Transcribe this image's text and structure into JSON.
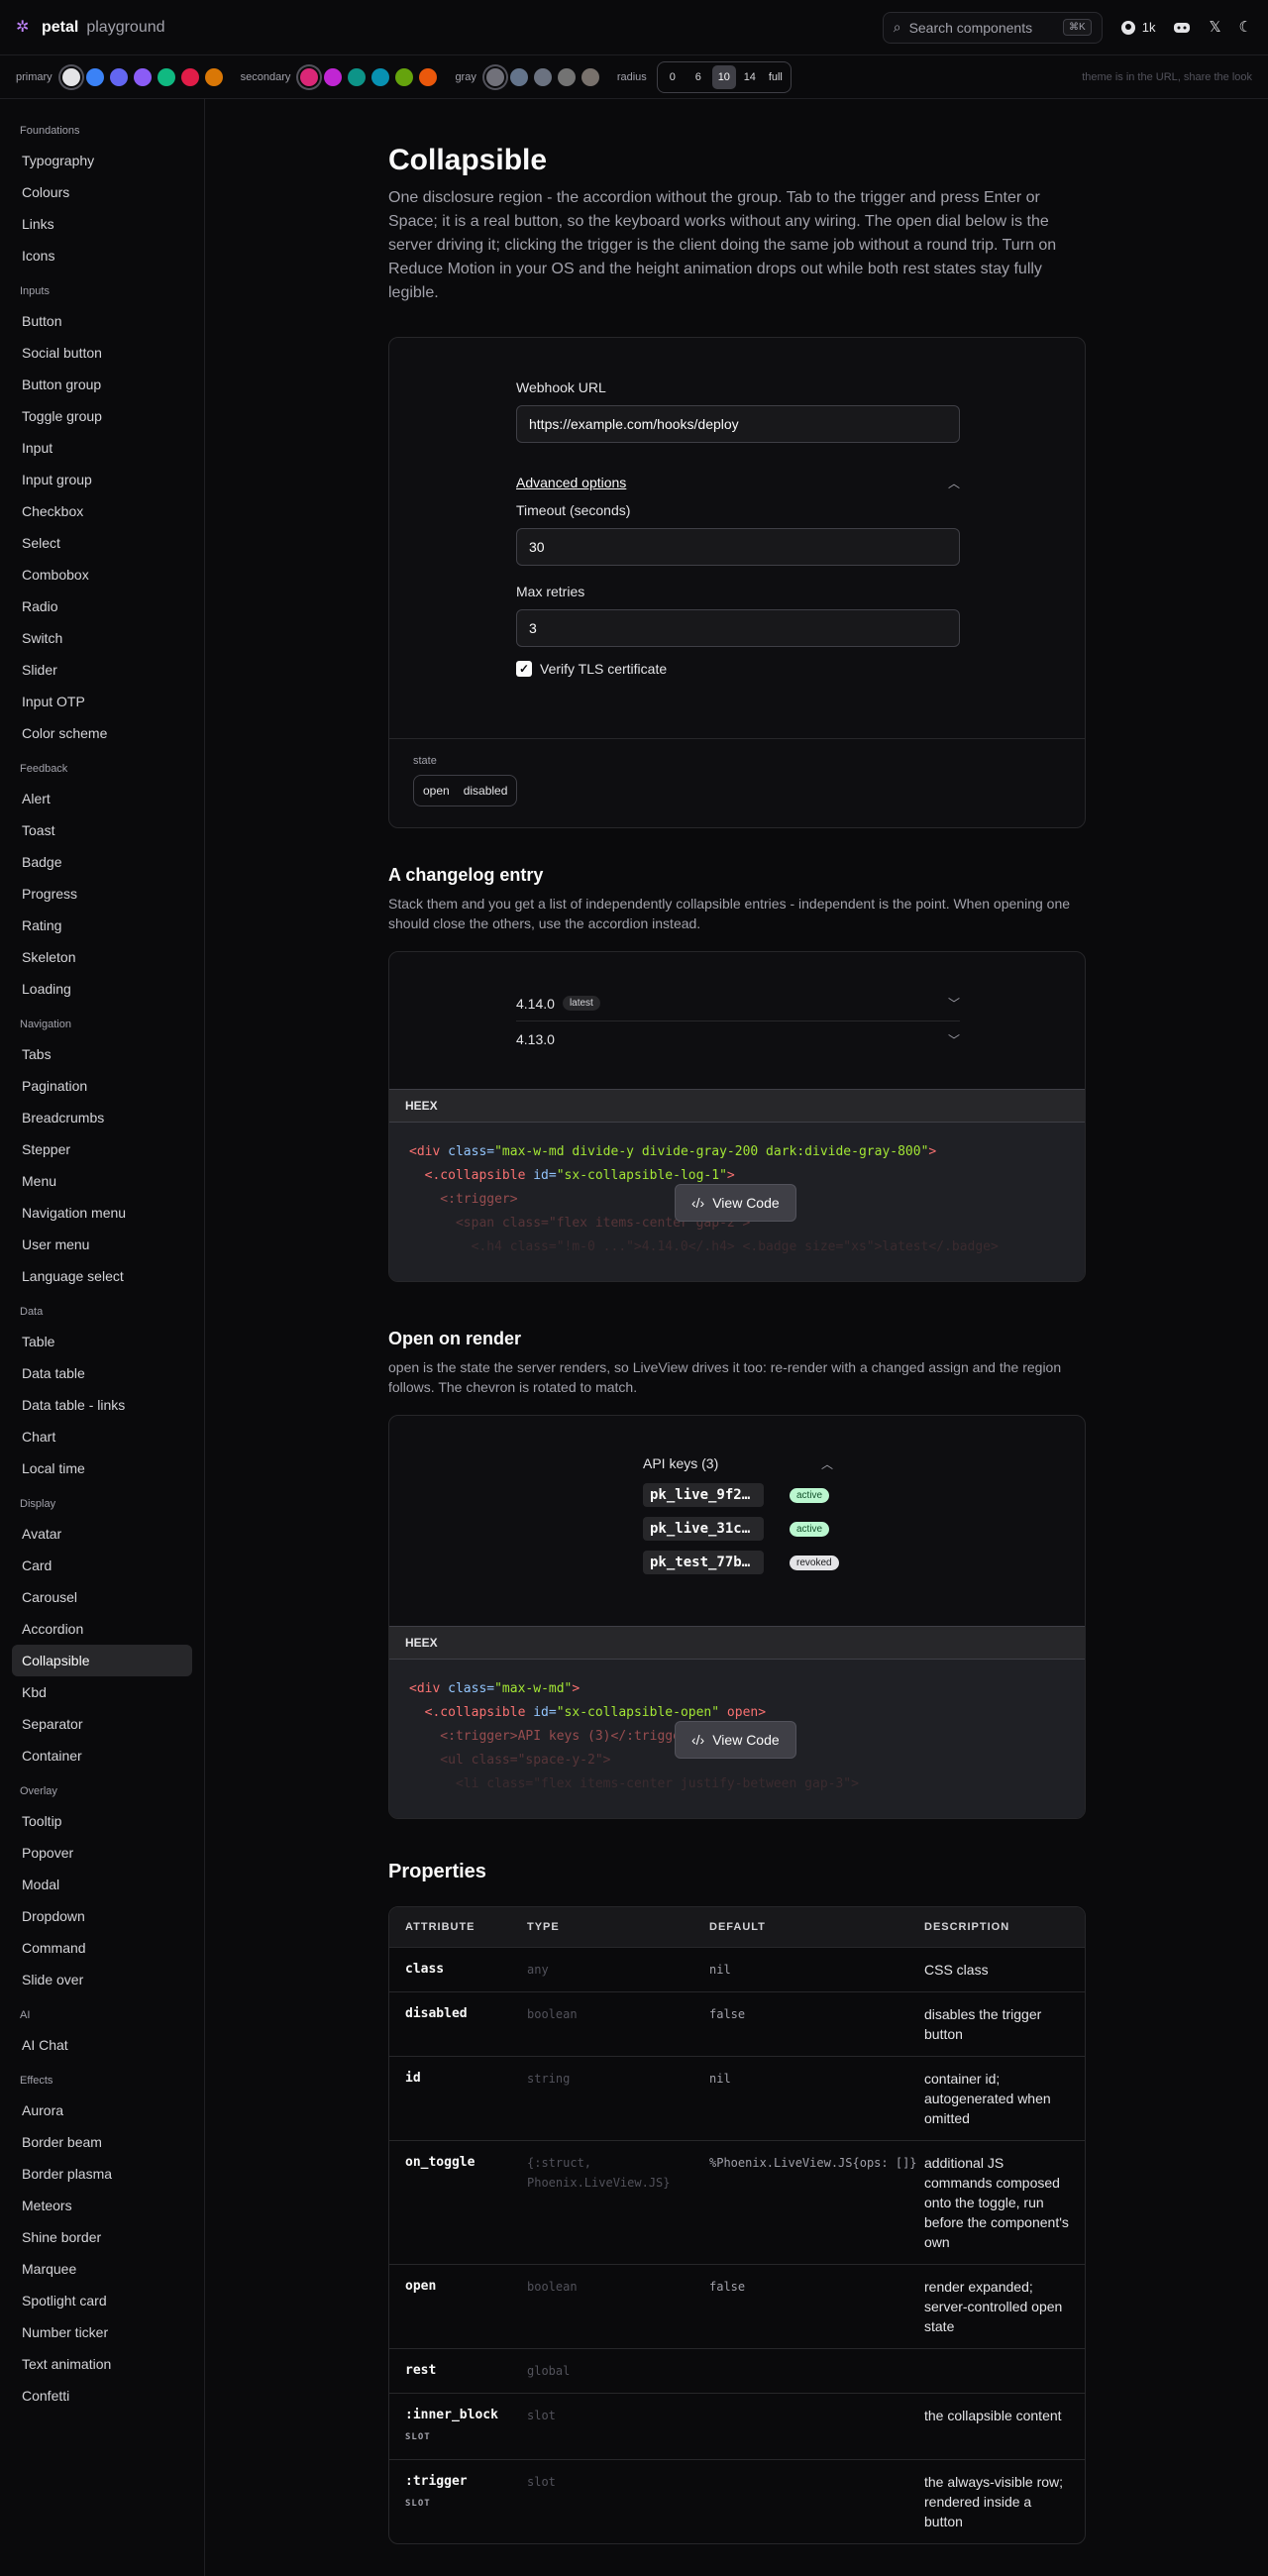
{
  "app": {
    "brand": "petal",
    "brand_sub": "playground"
  },
  "header": {
    "search_placeholder": "Search components",
    "search_kbd": "⌘K",
    "github_stars": "1k"
  },
  "theme": {
    "primary_label": "primary",
    "secondary_label": "secondary",
    "gray_label": "gray",
    "radius_label": "radius",
    "primary_colors": [
      "#e4e4e7",
      "#3b82f6",
      "#6366f1",
      "#8b5cf6",
      "#10b981",
      "#e11d48",
      "#d97706"
    ],
    "secondary_colors": [
      "#db2777",
      "#c026d3",
      "#0d9488",
      "#0891b2",
      "#65a30d",
      "#ea580c"
    ],
    "gray_colors": [
      "#71717a",
      "#64748b",
      "#6b7280",
      "#737373",
      "#78716c"
    ],
    "radius_options": [
      "0",
      "6",
      "10",
      "14",
      "full"
    ],
    "radius_selected": "10",
    "note": "theme is in the URL, share the look"
  },
  "sidebar": [
    {
      "title": "Foundations",
      "items": [
        "Typography",
        "Colours",
        "Links",
        "Icons"
      ]
    },
    {
      "title": "Inputs",
      "items": [
        "Button",
        "Social button",
        "Button group",
        "Toggle group",
        "Input",
        "Input group",
        "Checkbox",
        "Select",
        "Combobox",
        "Radio",
        "Switch",
        "Slider",
        "Input OTP",
        "Color scheme"
      ]
    },
    {
      "title": "Feedback",
      "items": [
        "Alert",
        "Toast",
        "Badge",
        "Progress",
        "Rating",
        "Skeleton",
        "Loading"
      ]
    },
    {
      "title": "Navigation",
      "items": [
        "Tabs",
        "Pagination",
        "Breadcrumbs",
        "Stepper",
        "Menu",
        "Navigation menu",
        "User menu",
        "Language select"
      ]
    },
    {
      "title": "Data",
      "items": [
        "Table",
        "Data table",
        "Data table - links",
        "Chart",
        "Local time"
      ]
    },
    {
      "title": "Display",
      "items": [
        "Avatar",
        "Card",
        "Carousel",
        "Accordion",
        "Collapsible",
        "Kbd",
        "Separator",
        "Container"
      ]
    },
    {
      "title": "Overlay",
      "items": [
        "Tooltip",
        "Popover",
        "Modal",
        "Dropdown",
        "Command",
        "Slide over"
      ]
    },
    {
      "title": "AI",
      "items": [
        "AI Chat"
      ]
    },
    {
      "title": "Effects",
      "items": [
        "Aurora",
        "Border beam",
        "Border plasma",
        "Meteors",
        "Shine border",
        "Marquee",
        "Spotlight card",
        "Number ticker",
        "Text animation",
        "Confetti"
      ]
    }
  ],
  "sidebar_active": "Collapsible",
  "page": {
    "title": "Collapsible",
    "lead": "One disclosure region - the accordion without the group. Tab to the trigger and press Enter or Space; it is a real button, so the keyboard works without any wiring. The open dial below is the server driving it; clicking the trigger is the client doing the same job without a round trip. Turn on Reduce Motion in your OS and the height animation drops out while both rest states stay fully legible."
  },
  "demo1": {
    "webhook_label": "Webhook URL",
    "webhook_value": "https://example.com/hooks/deploy",
    "advanced_label": "Advanced options",
    "timeout_label": "Timeout (seconds)",
    "timeout_value": "30",
    "retries_label": "Max retries",
    "retries_value": "3",
    "tls_label": "Verify TLS certificate",
    "tls_checked": true,
    "state_label": "state",
    "state_options": [
      "open",
      "disabled"
    ]
  },
  "changelog": {
    "title": "A changelog entry",
    "desc": "Stack them and you get a list of independently collapsible entries - independent is the point. When opening one should close the others, use the accordion instead.",
    "entries": [
      {
        "version": "4.14.0",
        "badge": "latest"
      },
      {
        "version": "4.13.0",
        "badge": ""
      }
    ],
    "code_label": "HEEX",
    "code_lines": [
      [
        "<div ",
        "class=",
        "\"max-w-md divide-y divide-gray-200 dark:divide-gray-800\"",
        ">"
      ],
      [
        "  <.collapsible ",
        "id=",
        "\"sx-collapsible-log-1\"",
        ">"
      ],
      [
        "    <:trigger>",
        "",
        "",
        ""
      ],
      [
        "      <span class=\"flex items-center gap-2\">",
        "",
        "",
        ""
      ],
      [
        "        <.h4 class=\"!m-0 ...\">4.14.0</.h4> <.badge size=\"xs\">latest</.badge>",
        "",
        "",
        ""
      ]
    ],
    "view_code": "View Code"
  },
  "open_render": {
    "title": "Open on render",
    "desc": "open is the state the server renders, so LiveView drives it too: re-render with a changed assign and the region follows. The chevron is rotated to match.",
    "heading": "API keys (3)",
    "keys": [
      {
        "key": "pk_live_9f2a...",
        "status": "active"
      },
      {
        "key": "pk_live_31cd...",
        "status": "active"
      },
      {
        "key": "pk_test_77be...",
        "status": "revoked"
      }
    ],
    "code_label": "HEEX",
    "code_lines": [
      [
        "<div ",
        "class=",
        "\"max-w-md\"",
        ">"
      ],
      [
        "  <.collapsible ",
        "id=",
        "\"sx-collapsible-open\"",
        " open>"
      ],
      [
        "    <:trigger>API keys (3)</:trigger>",
        "",
        "",
        ""
      ],
      [
        "    <ul class=\"space-y-2\">",
        "",
        "",
        ""
      ],
      [
        "      <li class=\"flex items-center justify-between gap-3\">",
        "",
        "",
        ""
      ]
    ],
    "view_code": "View Code"
  },
  "properties": {
    "title": "Properties",
    "headers": [
      "ATTRIBUTE",
      "TYPE",
      "DEFAULT",
      "DESCRIPTION"
    ],
    "rows": [
      {
        "attr": "class",
        "slot": "",
        "type": "any",
        "default": "nil",
        "desc": "CSS class"
      },
      {
        "attr": "disabled",
        "slot": "",
        "type": "boolean",
        "default": "false",
        "desc": "disables the trigger button"
      },
      {
        "attr": "id",
        "slot": "",
        "type": "string",
        "default": "nil",
        "desc": "container id; autogenerated when omitted"
      },
      {
        "attr": "on_toggle",
        "slot": "",
        "type": "{:struct, Phoenix.LiveView.JS}",
        "default": "%Phoenix.LiveView.JS{ops: []}",
        "desc": "additional JS commands composed onto the toggle, run before the component's own"
      },
      {
        "attr": "open",
        "slot": "",
        "type": "boolean",
        "default": "false",
        "desc": "render expanded; server-controlled open state"
      },
      {
        "attr": "rest",
        "slot": "",
        "type": "global",
        "default": "",
        "desc": ""
      },
      {
        "attr": ":inner_block",
        "slot": "SLOT",
        "type": "slot",
        "default": "",
        "desc": "the collapsible content"
      },
      {
        "attr": ":trigger",
        "slot": "SLOT",
        "type": "slot",
        "default": "",
        "desc": "the always-visible row; rendered inside a button"
      }
    ]
  }
}
